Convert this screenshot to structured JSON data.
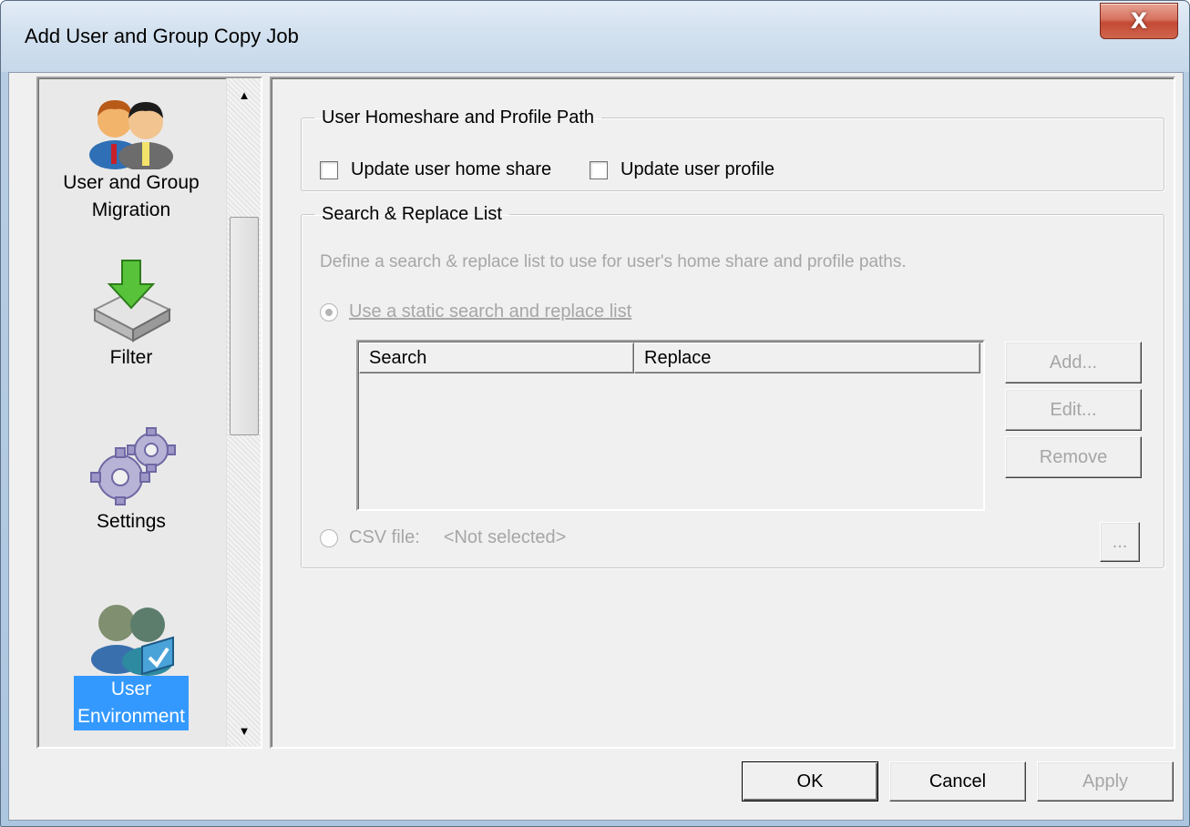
{
  "window": {
    "title": "Add User and Group Copy Job",
    "close_glyph": "X"
  },
  "sidebar": {
    "items": [
      {
        "label_line1": "User and Group",
        "label_line2": "Migration",
        "icon": "users-icon"
      },
      {
        "label_line1": "Filter",
        "label_line2": "",
        "icon": "filter-icon"
      },
      {
        "label_line1": "Settings",
        "label_line2": "",
        "icon": "gears-icon"
      },
      {
        "label_line1": "User",
        "label_line2": "Environment",
        "icon": "user-environment-icon",
        "selected": true
      }
    ],
    "scroll_up": "▲",
    "scroll_down": "▼"
  },
  "homeshare_group": {
    "legend": "User Homeshare and Profile Path",
    "update_home_share": "Update user home share",
    "update_profile": "Update user profile"
  },
  "search_replace_group": {
    "legend": "Search & Replace List",
    "description": "Define a search & replace list to use for user's home share and profile paths.",
    "static_radio_label": "Use a static search and replace list",
    "columns": [
      "Search",
      "Replace"
    ],
    "add_button": "Add...",
    "edit_button": "Edit...",
    "remove_button": "Remove",
    "csv_radio_label": "CSV file:",
    "csv_value": "<Not selected>",
    "browse_button": "..."
  },
  "footer": {
    "ok": "OK",
    "cancel": "Cancel",
    "apply": "Apply"
  },
  "colors": {
    "selection": "#3399ff",
    "disabled_text": "#a6a6a6",
    "close_button": "#c44a35"
  }
}
